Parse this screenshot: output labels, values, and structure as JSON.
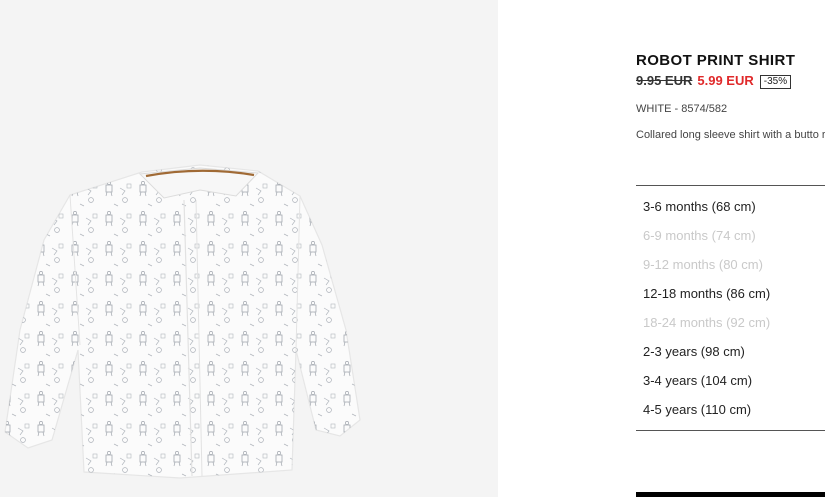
{
  "product": {
    "title": "ROBOT PRINT SHIRT",
    "old_price": "9.95 EUR",
    "new_price": "5.99 EUR",
    "discount": "-35%",
    "color_ref": "WHITE - 8574/582",
    "description": "Collared long sleeve shirt with a butto robot print."
  },
  "sizes": [
    {
      "label": "3-6 months (68 cm)",
      "available": true
    },
    {
      "label": "6-9 months (74 cm)",
      "available": false
    },
    {
      "label": "9-12 months (80 cm)",
      "available": false
    },
    {
      "label": "12-18 months (86 cm)",
      "available": true
    },
    {
      "label": "18-24 months (92 cm)",
      "available": false
    },
    {
      "label": "2-3 years (98 cm)",
      "available": true
    },
    {
      "label": "3-4 years (104 cm)",
      "available": true
    },
    {
      "label": "4-5 years (110 cm)",
      "available": true
    }
  ],
  "colors": {
    "sale": "#e0292a",
    "unavailable": "#c9c9c9",
    "image_bg": "#f4f4f4"
  },
  "image": {
    "subject": "white-shirt-with-robot-print"
  }
}
